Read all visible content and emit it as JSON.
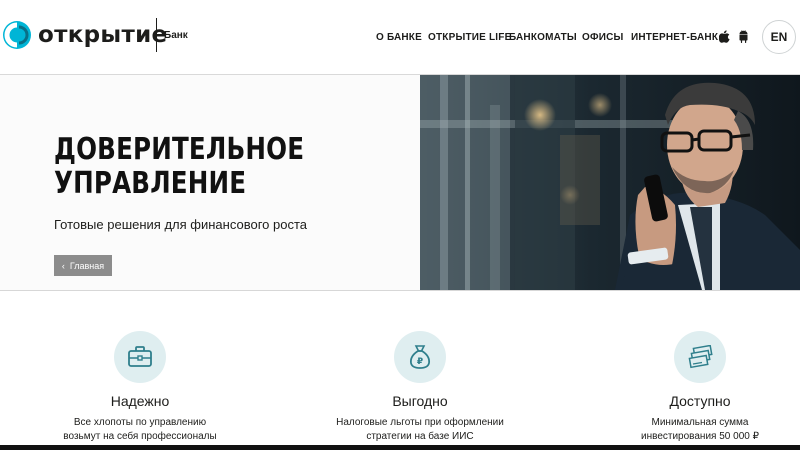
{
  "header": {
    "logo_text": "открытие",
    "logo_sub": "Банк",
    "nav": [
      "О БАНКЕ",
      "ОТКРЫТИЕ LIFE",
      "БАНКОМАТЫ",
      "ОФИСЫ",
      "ИНТЕРНЕТ-БАНК"
    ],
    "icons": [
      "apple-icon",
      "android-icon"
    ],
    "lang": "EN"
  },
  "hero": {
    "title_line1": "ДОВЕРИТЕЛЬНОЕ",
    "title_line2": "УПРАВЛЕНИЕ",
    "subtitle": "Готовые решения для финансового роста",
    "back_label": "Главная",
    "image": "businessman-on-phone"
  },
  "features": [
    {
      "icon": "briefcase-icon",
      "title": "Надежно",
      "desc_line1": "Все хлопоты по управлению",
      "desc_line2": "возьмут на себя профессионалы"
    },
    {
      "icon": "money-bag-icon",
      "title": "Выгодно",
      "desc_line1": "Налоговые льготы при оформлении",
      "desc_line2": "стратегии на базе ИИС"
    },
    {
      "icon": "money-stack-icon",
      "title": "Доступно",
      "desc_line1": "Минимальная сумма",
      "desc_line2": "инвестирования 50 000 ₽"
    }
  ],
  "colors": {
    "brand": "#00b5d6",
    "icon_bg": "#dfeef0",
    "button": "#8c8c8c",
    "text": "#1d1d1b"
  }
}
